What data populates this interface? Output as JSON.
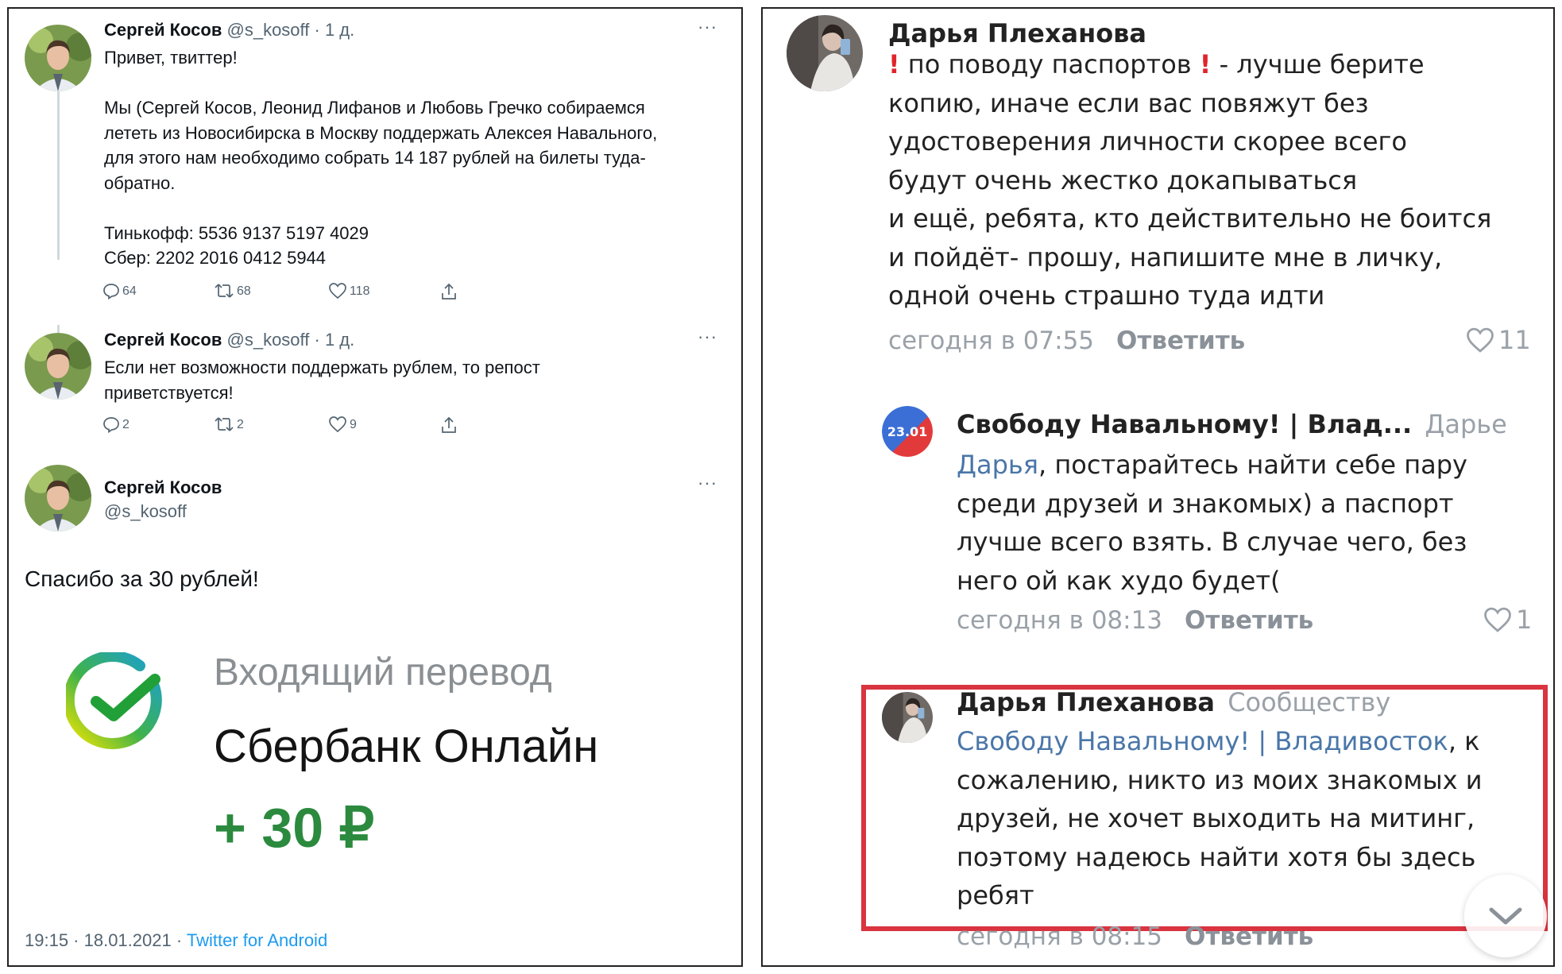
{
  "twitter": {
    "tweets": [
      {
        "name": "Сергей Косов",
        "handle": "@s_kosoff",
        "time": "· 1 д.",
        "more": "···",
        "text": "Привет, твиттер!\n\nМы (Сергей Косов, Леонид Лифанов и Любовь Гречко собираемся\nлететь из Новосибирска в Москву поддержать Алексея Навального,\nдля этого нам необходимо собрать 14 187 рублей на билеты туда-\nобратно.\n\nТинькофф: 5536 9137 5197 4029\nСбер: 2202 2016 0412 5944",
        "replies": "64",
        "retweets": "68",
        "likes": "118"
      },
      {
        "name": "Сергей Косов",
        "handle": "@s_kosoff",
        "time": "· 1 д.",
        "more": "···",
        "text": "Если нет возможности поддержать рублем, то репост\nприветствуется!",
        "replies": "2",
        "retweets": "2",
        "likes": "9"
      },
      {
        "name": "Сергей Косов",
        "handle": "@s_kosoff",
        "more": "···",
        "text": "Спасибо за 30 рублей!"
      }
    ],
    "transfer": {
      "title": "Входящий перевод",
      "bank": "Сбербанк Онлайн",
      "amount": "+ 30 ₽",
      "brand_color": "#21a038"
    },
    "footer": {
      "datetime": "19:15 · 18.01.2021 · ",
      "source": "Twitter for Android"
    }
  },
  "vk": {
    "comments": [
      {
        "name": "Дарья Плеханова",
        "line1_text": " по поводу паспортов ",
        "line1_tail": " - лучше берите",
        "text_rest": "копию, иначе если вас повяжут без\nудостоверения личности скорее всего\nбудут очень жестко докапываться\nи ещё, ребята, кто действительно не боится\nи пойдёт- прошу, напишите мне в личку,\nодной очень страшно туда идти",
        "time": "сегодня в 07:55",
        "reply": "Ответить",
        "likes": "11"
      },
      {
        "name": "Свободу Навальному! | Влад...",
        "avatar_label": "23.01",
        "to": "Дарье",
        "mention": "Дарья",
        "text_first": ", постарайтесь найти себе пару",
        "text_rest": "среди друзей и знакомых) а паспорт\nлучше всего взять. В случае чего, без\nнего ой как худо будет(",
        "time": "сегодня в 08:13",
        "reply": "Ответить",
        "likes": "1"
      },
      {
        "name": "Дарья Плеханова",
        "to": "Сообществу",
        "mention": "Свободу Навальному! | Владивосток",
        "text_first": ", к",
        "text_rest": "сожалению, никто из моих знакомых и\nдрузей, не хочет выходить на митинг,\nпоэтому надеюсь найти хотя бы здесь\nребят",
        "time": "сегодня в 08:15",
        "reply": "Ответить"
      }
    ],
    "link_color": "#4a76a8",
    "highlight_color": "#d9343f"
  }
}
